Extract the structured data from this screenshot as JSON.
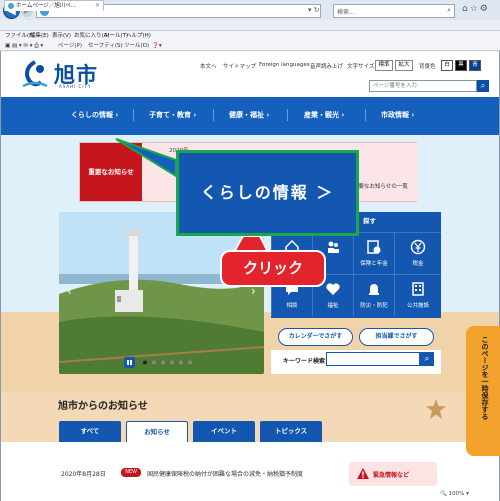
{
  "browser": {
    "back_icon": "arrow-left-icon",
    "tab_title": "ホームページ／旭川ペ...",
    "search_placeholder": "検索...",
    "menu": [
      "ファイル(F)",
      "編集(E)",
      "表示(V)",
      "お気に入り(A)",
      "ツール(T)",
      "ヘルプ(H)"
    ],
    "cmd": [
      "ページ(P)",
      "セーフティ(S)",
      "ツール(O)"
    ],
    "zoom": "100%"
  },
  "header": {
    "logo_text": "旭市",
    "logo_sub": "ASAHI CITY",
    "links": [
      "本文へ",
      "サイトマップ",
      "Foreign languages",
      "音声読み上げ"
    ],
    "font_size_label": "文字サイズ",
    "size_standard": "標準",
    "size_large": "拡大",
    "bg_color_label": "背景色",
    "color_white": "白",
    "color_black": "黒",
    "color_blue": "青",
    "search_placeholder": "ページ番号を入力"
  },
  "nav": {
    "items": [
      "くらしの情報",
      "子育て・教育",
      "健康・福祉",
      "産業・観光",
      "市政情報"
    ]
  },
  "notice": {
    "label": "重要なお知らせ",
    "date": "2020年",
    "more": "重要なお知らせの一覧"
  },
  "topics": {
    "head": "探す",
    "cells": [
      {
        "label": "",
        "icon": "house-icon"
      },
      {
        "label": "",
        "icon": "people-icon"
      },
      {
        "label": "保険と年金",
        "icon": "insurance-icon"
      },
      {
        "label": "税金",
        "icon": "yen-icon"
      },
      {
        "label": "相談",
        "icon": "chat-icon"
      },
      {
        "label": "福祉",
        "icon": "heart-icon"
      },
      {
        "label": "防災・防犯",
        "icon": "alarm-icon"
      },
      {
        "label": "公共施設",
        "icon": "building-icon"
      }
    ]
  },
  "quick": {
    "calendar": "カレンダーでさがす",
    "department": "担当課でさがす",
    "keyword_label": "キーワード検索"
  },
  "news": {
    "heading": "旭市からのお知らせ",
    "tabs": [
      "すべて",
      "お知らせ",
      "イベント",
      "トピックス"
    ],
    "items": [
      {
        "date": "2020年8月28日",
        "badge": "NEW",
        "title": "国民健康保険税の納付が困難な場合の減免・納税猶予制度"
      }
    ]
  },
  "emergency": {
    "label": "緊急情報など"
  },
  "side_tab": {
    "label": "このページを一時保存する"
  },
  "overlay": {
    "label": "くらしの情報 ＞",
    "click": "クリック"
  },
  "colors": {
    "brand_blue": "#1560bd",
    "alert_red": "#c4161c",
    "callout_green": "#1aa64a",
    "sand": "#f3d9b5"
  }
}
